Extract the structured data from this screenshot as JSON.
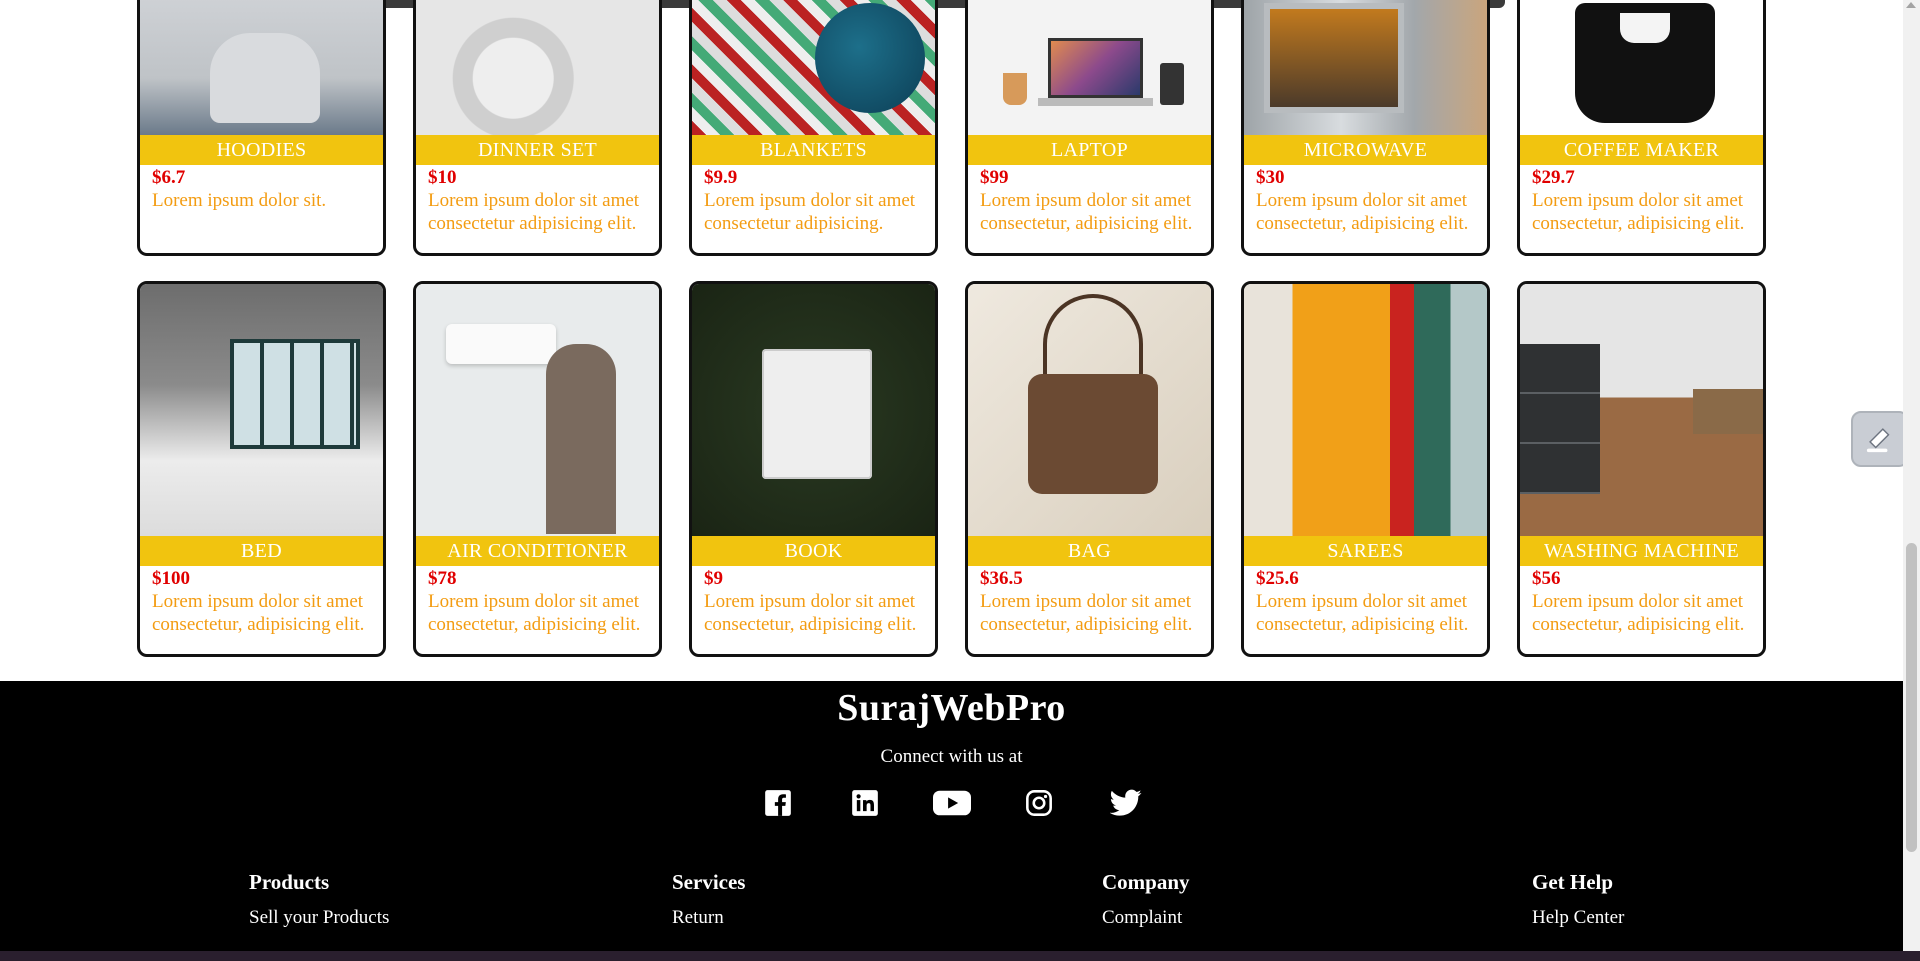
{
  "products_row1": [
    {
      "title": "HOODIES",
      "price": "$6.7",
      "desc": "Lorem ipsum dolor sit.",
      "img": "hoodie"
    },
    {
      "title": "DINNER SET",
      "price": "$10",
      "desc": "Lorem ipsum dolor sit amet consectetur adipisicing elit.",
      "img": "dinner"
    },
    {
      "title": "BLANKETS",
      "price": "$9.9",
      "desc": "Lorem ipsum dolor sit amet consectetur adipisicing.",
      "img": "blanket"
    },
    {
      "title": "LAPTOP",
      "price": "$99",
      "desc": "Lorem ipsum dolor sit amet consectetur, adipisicing elit.",
      "img": "laptop"
    },
    {
      "title": "MICROWAVE",
      "price": "$30",
      "desc": "Lorem ipsum dolor sit amet consectetur, adipisicing elit.",
      "img": "micro"
    },
    {
      "title": "COFFEE MAKER",
      "price": "$29.7",
      "desc": "Lorem ipsum dolor sit amet consectetur, adipisicing elit.",
      "img": "coffee"
    }
  ],
  "products_row2": [
    {
      "title": "BED",
      "price": "$100",
      "desc": "Lorem ipsum dolor sit amet consectetur, adipisicing elit.",
      "img": "bed"
    },
    {
      "title": "AIR CONDITIONER",
      "price": "$78",
      "desc": "Lorem ipsum dolor sit amet consectetur, adipisicing elit.",
      "img": "ac"
    },
    {
      "title": "BOOK",
      "price": "$9",
      "desc": "Lorem ipsum dolor sit amet consectetur, adipisicing elit.",
      "img": "book"
    },
    {
      "title": "BAG",
      "price": "$36.5",
      "desc": "Lorem ipsum dolor sit amet consectetur, adipisicing elit.",
      "img": "bag"
    },
    {
      "title": "SAREES",
      "price": "$25.6",
      "desc": "Lorem ipsum dolor sit amet consectetur, adipisicing elit.",
      "img": "saree"
    },
    {
      "title": "WASHING MACHINE",
      "price": "$56",
      "desc": "Lorem ipsum dolor sit amet consectetur, adipisicing elit.",
      "img": "wash"
    }
  ],
  "footer": {
    "brand": "SurajWebPro",
    "connect": "Connect with us at",
    "socials": [
      "facebook-icon",
      "linkedin-icon",
      "youtube-icon",
      "instagram-icon",
      "twitter-icon"
    ],
    "columns": [
      {
        "heading": "Products",
        "links": [
          "Sell your Products"
        ]
      },
      {
        "heading": "Services",
        "links": [
          "Return"
        ]
      },
      {
        "heading": "Company",
        "links": [
          "Complaint"
        ]
      },
      {
        "heading": "Get Help",
        "links": [
          "Help Center"
        ]
      }
    ]
  },
  "colors": {
    "title_bar": "#f1c40f",
    "price": "#e00000",
    "desc": "#f39c12",
    "footer_bg": "#000000"
  }
}
